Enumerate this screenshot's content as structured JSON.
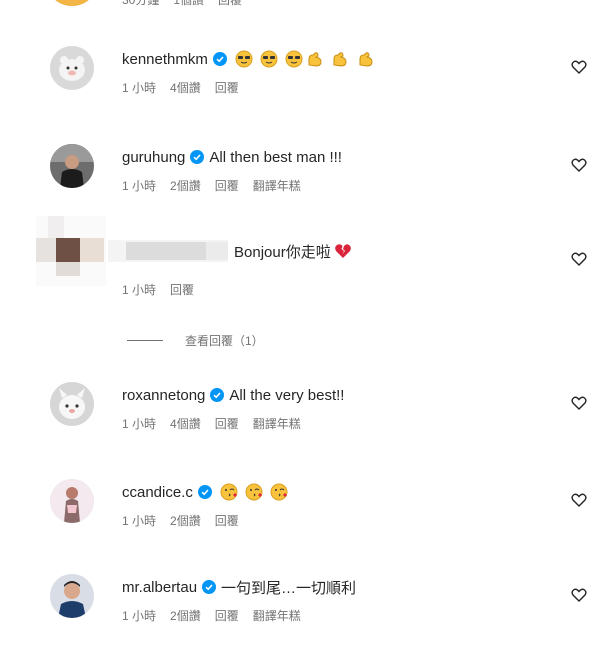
{
  "top_partial": {
    "time": "30分鐘",
    "likes": "1個讚",
    "reply": "回覆"
  },
  "comments": [
    {
      "username": "kennethmkm",
      "text": "",
      "time": "1 小時",
      "likes": "4個讚",
      "reply": "回覆",
      "translate": ""
    },
    {
      "username": "guruhung",
      "text": "All then best man !!!",
      "time": "1 小時",
      "likes": "2個讚",
      "reply": "回覆",
      "translate": "翻譯年糕"
    },
    {
      "username": "",
      "text": "Bonjour你走啦",
      "time": "1 小時",
      "likes": "",
      "reply": "回覆",
      "translate": ""
    },
    {
      "username": "roxannetong",
      "text": "All the very best!!",
      "time": "1 小時",
      "likes": "4個讚",
      "reply": "回覆",
      "translate": "翻譯年糕"
    },
    {
      "username": "ccandice.c",
      "text": "",
      "time": "1 小時",
      "likes": "2個讚",
      "reply": "回覆",
      "translate": ""
    },
    {
      "username": "mr.albertau",
      "text": "一句到尾…一切順利",
      "time": "1 小時",
      "likes": "2個讚",
      "reply": "回覆",
      "translate": "翻譯年糕"
    }
  ],
  "view_replies": "查看回覆（1）",
  "colors": {
    "verified": "#0095f6",
    "meta": "#737373",
    "text": "#262626"
  },
  "icons": {
    "verified": "verified-badge-icon",
    "like": "heart-outline-icon"
  }
}
